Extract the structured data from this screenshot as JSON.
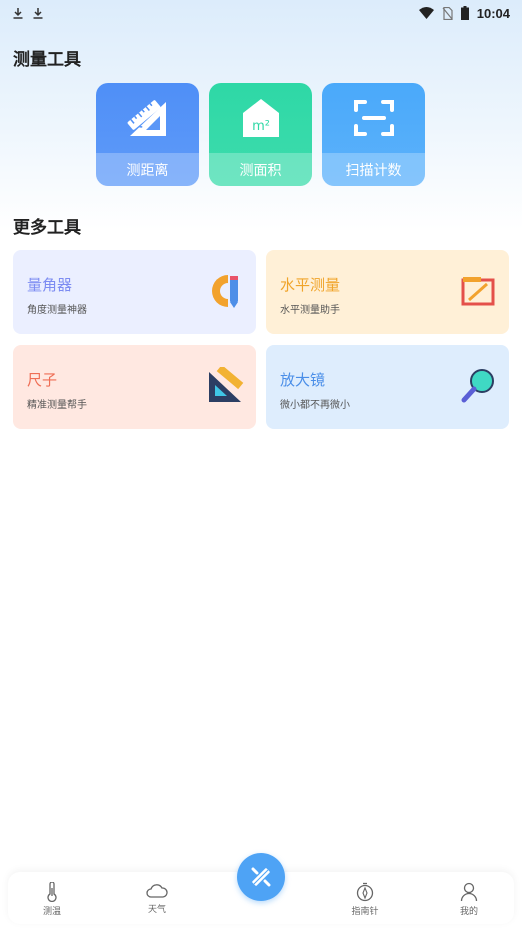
{
  "status_bar": {
    "time": "10:04",
    "left_icons": [
      "download-icon",
      "download-icon"
    ],
    "right_icons": [
      "wifi-icon",
      "no-sim-icon",
      "battery-icon"
    ]
  },
  "sections": {
    "measure_tools_title": "测量工具",
    "more_tools_title": "更多工具"
  },
  "tools": [
    {
      "label": "测距离",
      "icon": "ruler-triangle-icon",
      "color": "#4f8ff7"
    },
    {
      "label": "测面积",
      "icon": "house-area-icon",
      "color": "#2ed8a6"
    },
    {
      "label": "扫描计数",
      "icon": "scan-frame-icon",
      "color": "#4aa9fa"
    }
  ],
  "more_tools": [
    {
      "title": "量角器",
      "subtitle": "角度测量神器",
      "title_color": "#7d8cf2",
      "bg": "#ebefff",
      "icon": "protractor-icon"
    },
    {
      "title": "水平测量",
      "subtitle": "水平测量助手",
      "title_color": "#f0a42a",
      "bg": "#fff0d7",
      "icon": "level-icon"
    },
    {
      "title": "尺子",
      "subtitle": "精准测量帮手",
      "title_color": "#ef6e55",
      "bg": "#ffe8e1",
      "icon": "triangle-ruler-icon"
    },
    {
      "title": "放大镜",
      "subtitle": "微小都不再微小",
      "title_color": "#4a8ee8",
      "bg": "#deedfd",
      "icon": "magnifier-icon"
    }
  ],
  "bottom_nav": [
    {
      "label": "测温",
      "icon": "thermometer-icon"
    },
    {
      "label": "天气",
      "icon": "cloud-icon"
    },
    {
      "label": "指南针",
      "icon": "compass-icon"
    },
    {
      "label": "我的",
      "icon": "person-icon"
    }
  ],
  "fab": {
    "icon": "ruler-pencil-icon"
  }
}
